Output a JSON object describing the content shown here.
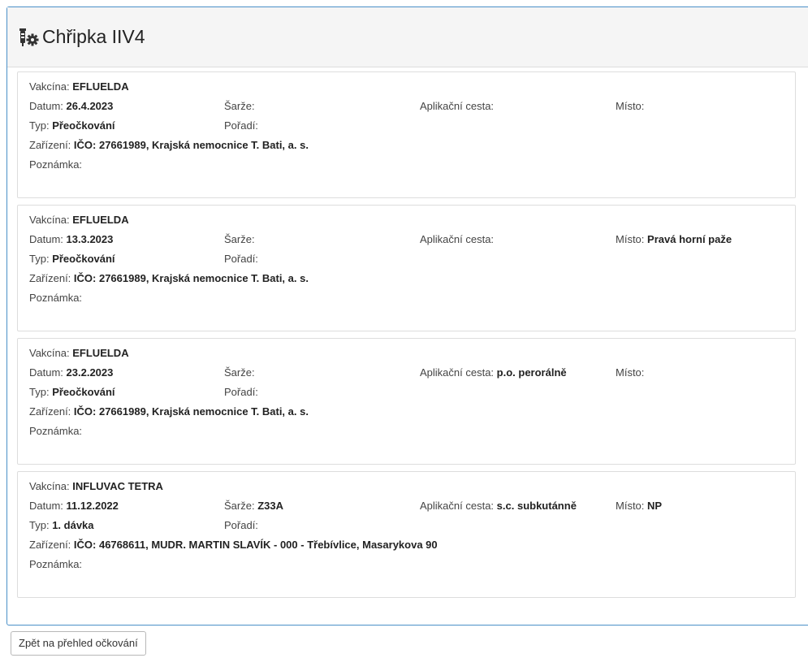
{
  "page": {
    "title": "Chřipka IIV4",
    "icon": "vaccine-gear-icon",
    "back_button_label": "Zpět na přehled očkování"
  },
  "labels": {
    "vaccine": "Vakcína:",
    "date": "Datum:",
    "batch": "Šarže:",
    "route": "Aplikační cesta:",
    "site": "Místo:",
    "type": "Typ:",
    "order": "Pořadí:",
    "facility": "Zařízení:",
    "note": "Poznámka:"
  },
  "records": [
    {
      "vaccine": "EFLUELDA",
      "date": "26.4.2023",
      "batch": "",
      "route": "",
      "site": "",
      "type": "Přeočkování",
      "order": "",
      "facility": "IČO: 27661989, Krajská nemocnice T. Bati, a. s.",
      "note": ""
    },
    {
      "vaccine": "EFLUELDA",
      "date": "13.3.2023",
      "batch": "",
      "route": "",
      "site": "Pravá horní paže",
      "type": "Přeočkování",
      "order": "",
      "facility": "IČO: 27661989, Krajská nemocnice T. Bati, a. s.",
      "note": ""
    },
    {
      "vaccine": "EFLUELDA",
      "date": "23.2.2023",
      "batch": "",
      "route": "p.o. perorálně",
      "site": "",
      "type": "Přeočkování",
      "order": "",
      "facility": "IČO: 27661989, Krajská nemocnice T. Bati, a. s.",
      "note": ""
    },
    {
      "vaccine": "INFLUVAC TETRA",
      "date": "11.12.2022",
      "batch": "Z33A",
      "route": "s.c. subkutánně",
      "site": "NP",
      "type": "1. dávka",
      "order": "",
      "facility": "IČO: 46768611, MUDR. MARTIN SLAVÍK - 000 - Třebívlice, Masarykova 90",
      "note": ""
    }
  ]
}
